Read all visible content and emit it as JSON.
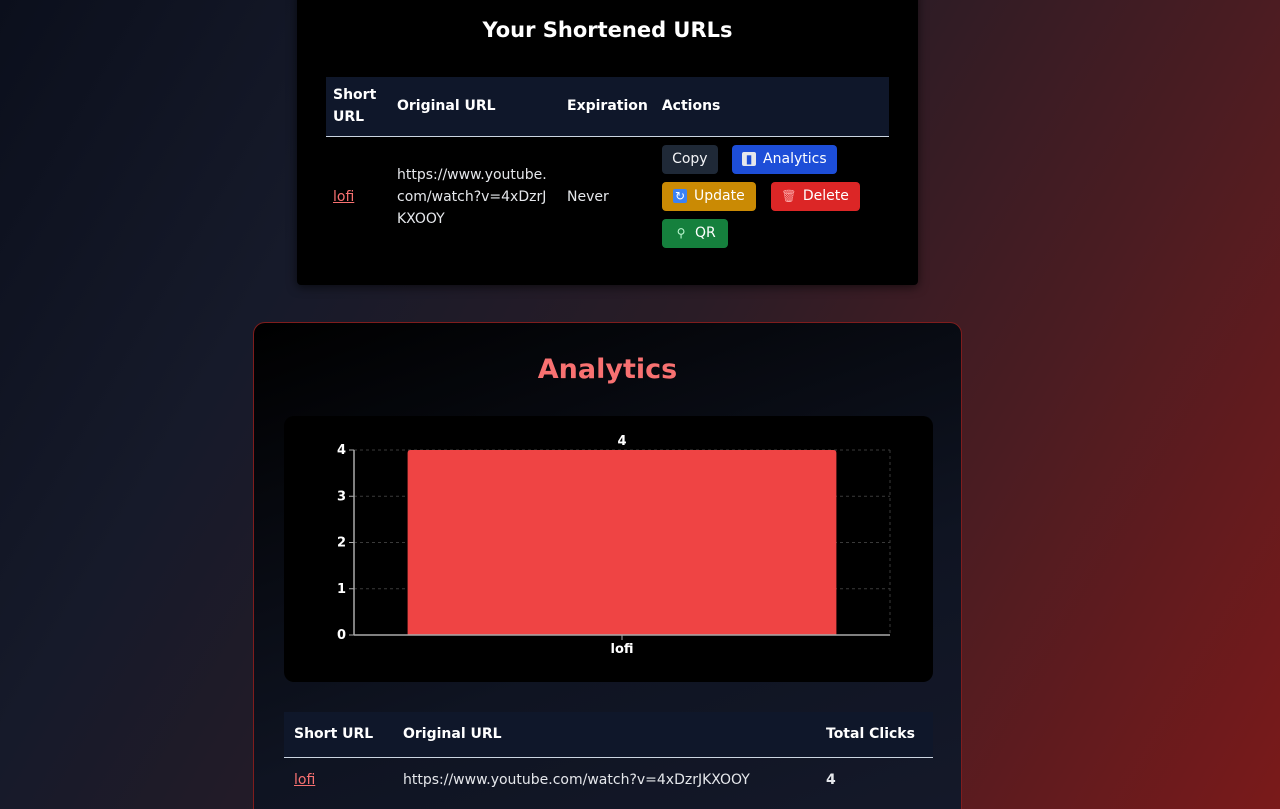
{
  "urls_section": {
    "title": "Your Shortened URLs",
    "columns": [
      "Short URL",
      "Original URL",
      "Expiration",
      "Actions"
    ],
    "rows": [
      {
        "short_url": "lofi",
        "original_url": "https://www.youtube.com/watch?v=4xDzrJKXOOY",
        "expiration": "Never"
      }
    ],
    "actions": {
      "copy": "Copy",
      "analytics": "Analytics",
      "update": "Update",
      "delete": "Delete",
      "qr": "QR"
    },
    "colors": {
      "copy": "#1f2937",
      "analytics": "#1d4ed8",
      "update": "#ca8a04",
      "delete": "#dc2626",
      "qr": "#15803d"
    },
    "icons": {
      "analytics": "bar-chart-icon",
      "update": "refresh-icon",
      "delete": "trash-icon",
      "qr": "qr-icon"
    }
  },
  "analytics_section": {
    "title": "Analytics",
    "table_columns": [
      "Short URL",
      "Original URL",
      "Total Clicks"
    ],
    "table_rows": [
      {
        "short_url": "lofi",
        "original_url": "https://www.youtube.com/watch?v=4xDzrJKXOOY",
        "total_clicks": "4"
      }
    ]
  },
  "chart_data": {
    "type": "bar",
    "categories": [
      "lofi"
    ],
    "values": [
      4
    ],
    "data_labels": [
      "4"
    ],
    "title": "",
    "xlabel": "",
    "ylabel": "",
    "ylim": [
      0,
      4
    ],
    "yticks": [
      0,
      1,
      2,
      3,
      4
    ],
    "grid": true,
    "bar_color": "#ef4444"
  }
}
